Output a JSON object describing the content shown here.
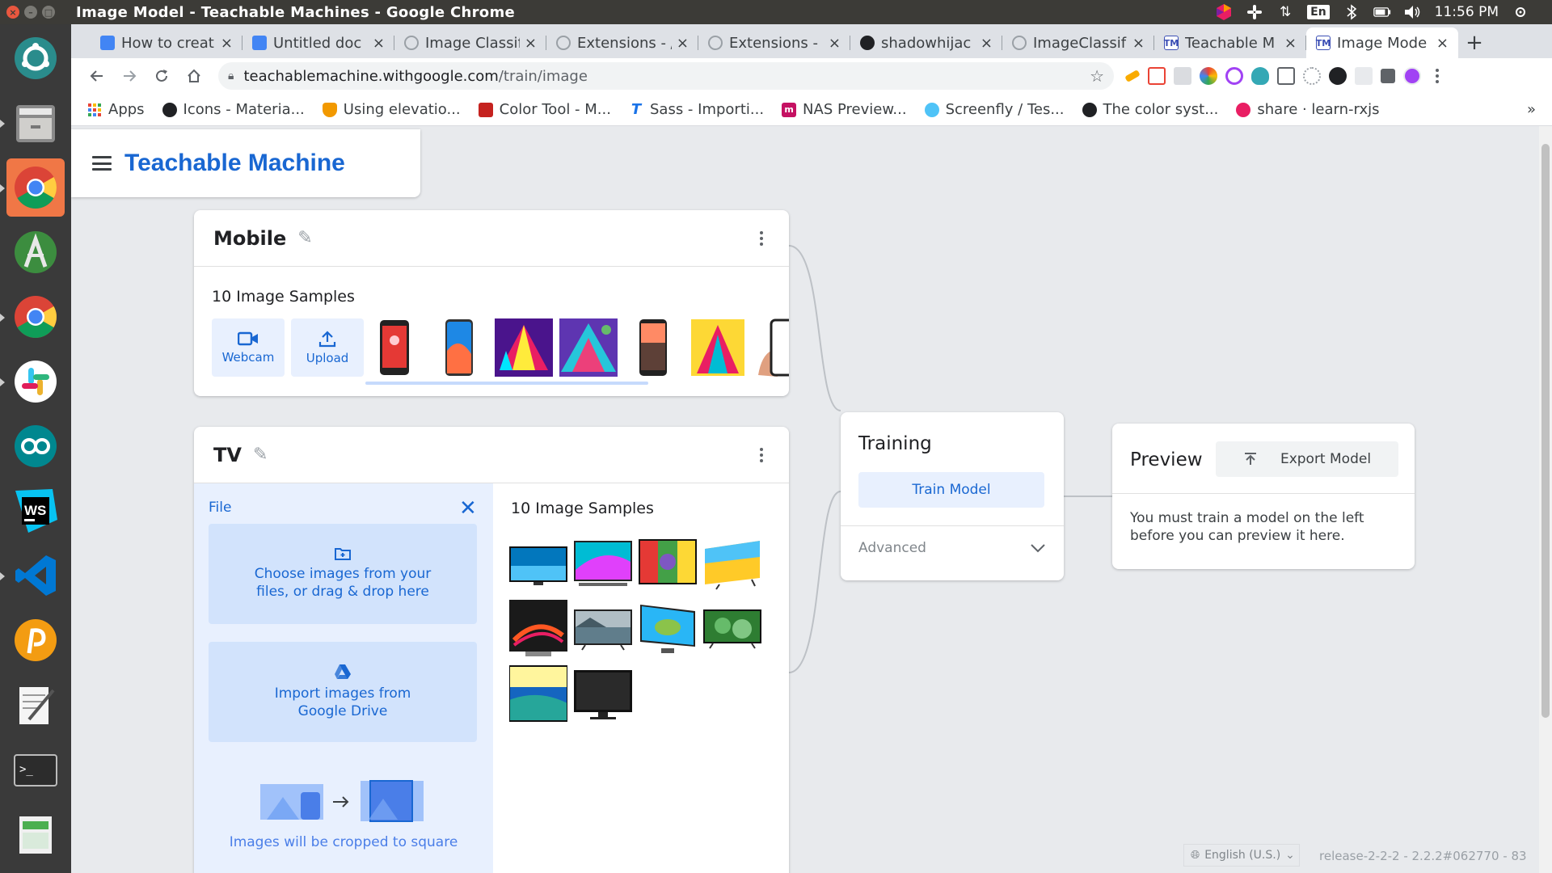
{
  "window": {
    "title": "Image Model - Teachable Machines - Google Chrome",
    "clock": "11:56 PM",
    "lang_indicator": "En"
  },
  "launcher": {
    "apps": [
      "ubuntu-software-icon",
      "files-icon",
      "chrome-icon",
      "android-studio-icon",
      "chrome-icon",
      "slack-icon",
      "arduino-icon",
      "webstorm-icon",
      "vscode-icon",
      "postman-icon",
      "text-editor-icon",
      "terminal-icon",
      "calc-icon"
    ]
  },
  "tabs": [
    {
      "label": "How to creat",
      "favicon_color": "#4285f4"
    },
    {
      "label": "Untitled doc",
      "favicon_color": "#4285f4"
    },
    {
      "label": "Image Classif",
      "favicon_color": "#9aa0a6"
    },
    {
      "label": "Extensions - /",
      "favicon_color": "#9aa0a6"
    },
    {
      "label": "Extensions -",
      "favicon_color": "#9aa0a6"
    },
    {
      "label": "shadowhijac",
      "favicon_color": "#202124"
    },
    {
      "label": "ImageClassif",
      "favicon_color": "#9aa0a6"
    },
    {
      "label": "Teachable M",
      "favicon_color": "#3c4fb5"
    },
    {
      "label": "Image Mode",
      "favicon_color": "#3c4fb5",
      "active": true
    }
  ],
  "address": {
    "host": "teachablemachine.withgoogle.com",
    "path": "/train/image"
  },
  "bookmarks": [
    {
      "label": "Apps",
      "color": "#ea4335"
    },
    {
      "label": "Icons - Materia...",
      "color": "#202124"
    },
    {
      "label": "Using elevatio...",
      "color": "#f29900"
    },
    {
      "label": "Color Tool - M...",
      "color": "#c5221f"
    },
    {
      "label": "Sass - Importi...",
      "color": "#1a73e8"
    },
    {
      "label": "NAS Preview...",
      "color": "#c51162"
    },
    {
      "label": "Screenfly / Tes...",
      "color": "#4fc3f7"
    },
    {
      "label": "The color syst...",
      "color": "#202124"
    },
    {
      "label": "share · learn-rxjs",
      "color": "#e91e63"
    }
  ],
  "app": {
    "brand": "Teachable Machine",
    "brand_color": "#1967d2"
  },
  "mobile_class": {
    "name": "Mobile",
    "samples_label": "10 Image Samples",
    "webcam_label": "Webcam",
    "upload_label": "Upload"
  },
  "tv_class": {
    "name": "TV",
    "file_label": "File",
    "choose_files": "Choose images from your files, or drag & drop here",
    "import_drive": "Import images from Google Drive",
    "crop_note": "Images will be cropped to square",
    "samples_label": "10 Image Samples"
  },
  "training": {
    "title": "Training",
    "train_button": "Train Model",
    "advanced_label": "Advanced"
  },
  "preview": {
    "title": "Preview",
    "export_button": "Export Model",
    "message": "You must train a model on the left before you can preview it here."
  },
  "footer": {
    "language": "English (U.S.)",
    "release": "release-2-2-2 - 2.2.2#062770 - 83"
  }
}
